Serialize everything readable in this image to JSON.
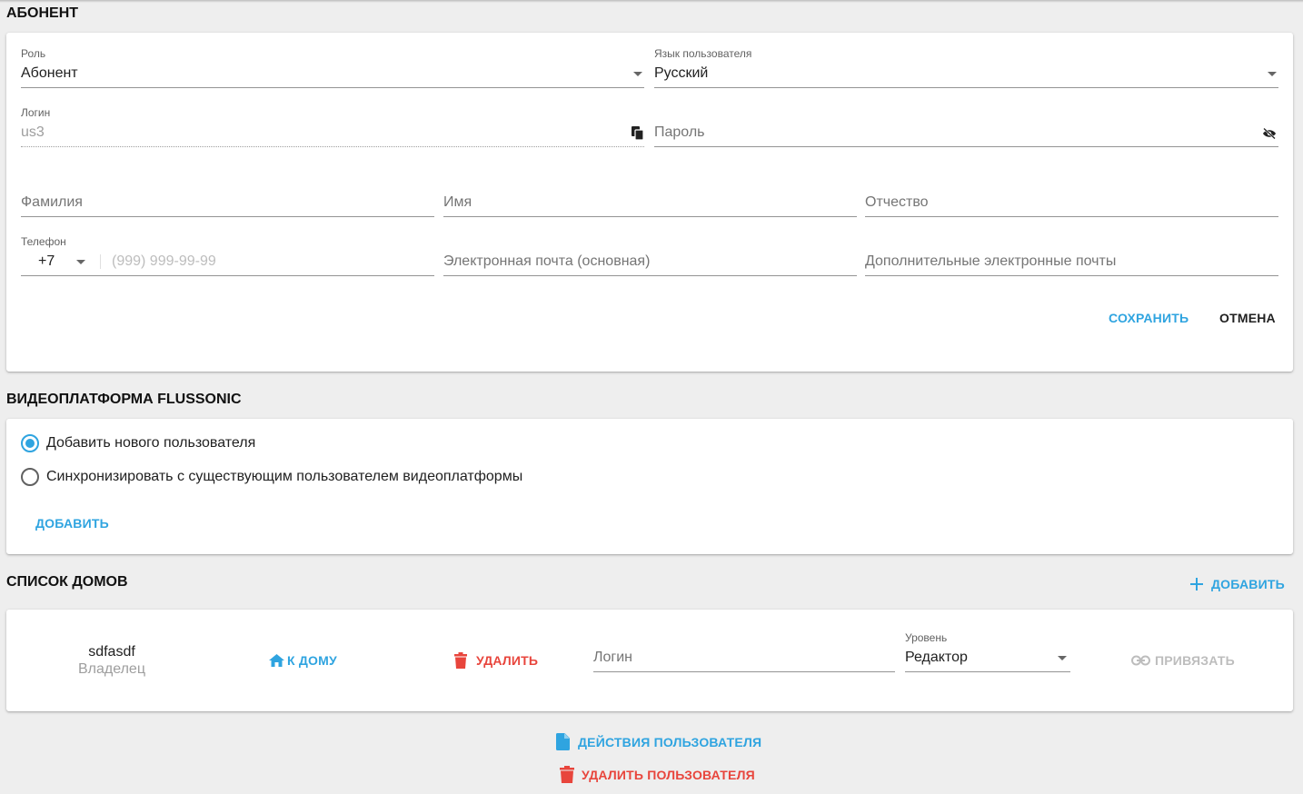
{
  "subscriber": {
    "title": "АБОНЕНТ",
    "role": {
      "label": "Роль",
      "value": "Абонент"
    },
    "language": {
      "label": "Язык пользователя",
      "value": "Русский"
    },
    "login": {
      "label": "Логин",
      "value": "us3"
    },
    "password": {
      "placeholder": "Пароль"
    },
    "last_name": {
      "placeholder": "Фамилия"
    },
    "first_name": {
      "placeholder": "Имя"
    },
    "middle_name": {
      "placeholder": "Отчество"
    },
    "phone": {
      "label": "Телефон",
      "code": "+7",
      "placeholder": "(999) 999-99-99"
    },
    "email": {
      "placeholder": "Электронная почта (основная)"
    },
    "extra_emails": {
      "placeholder": "Дополнительные электронные почты"
    },
    "save_label": "СОХРАНИТЬ",
    "cancel_label": "ОТМЕНА"
  },
  "video_platform": {
    "title": "ВИДЕОПЛАТФОРМА FLUSSONIC",
    "options": [
      {
        "label": "Добавить нового пользователя",
        "selected": true
      },
      {
        "label": "Синхронизировать с существующим пользователем видеоплатформы",
        "selected": false
      }
    ],
    "add_label": "ДОБАВИТЬ"
  },
  "houses": {
    "title": "СПИСОК ДОМОВ",
    "add_label": "ДОБАВИТЬ",
    "items": [
      {
        "name": "sdfasdf",
        "role": "Владелец",
        "goto_label": "К ДОМУ",
        "delete_label": "УДАЛИТЬ",
        "login_placeholder": "Логин",
        "level_label": "Уровень",
        "level_value": "Редактор",
        "bind_label": "ПРИВЯЗАТЬ"
      }
    ]
  },
  "footer": {
    "actions_label": "ДЕЙСТВИЯ ПОЛЬЗОВАТЕЛЯ",
    "delete_user_label": "УДАЛИТЬ ПОЛЬЗОВАТЕЛЯ"
  },
  "colors": {
    "accent": "#2fa4e0",
    "danger": "#e8453c",
    "disabled": "#bdbdbd"
  },
  "icons": [
    "copy-icon",
    "eye-off-icon",
    "home-icon",
    "trash-icon",
    "link-icon",
    "plus-icon",
    "file-icon"
  ]
}
